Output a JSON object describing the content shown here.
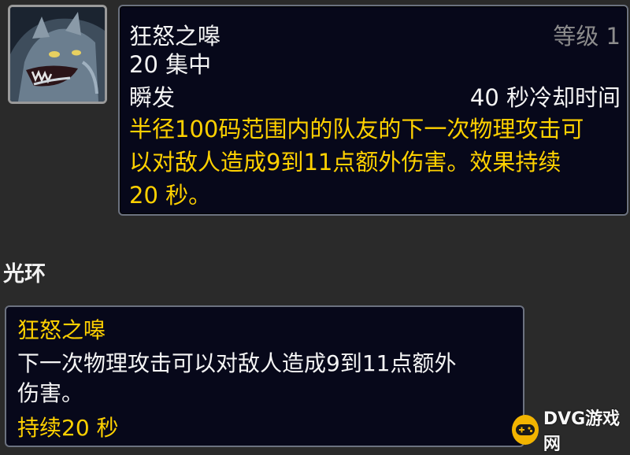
{
  "spell": {
    "name": "狂怒之嗥",
    "rank": "等级 1",
    "cost": "20 集中",
    "cast_time": "瞬发",
    "cooldown": "40 秒冷却时间",
    "description_lines": [
      "半径100码范围内的队友的下一次物理攻击可",
      "以对敌人造成9到11点额外伤害。效果持续",
      "20 秒。"
    ],
    "icon": "wolf-howl-icon"
  },
  "aura_section": {
    "heading": "光环",
    "name": "狂怒之嗥",
    "description_lines": [
      "下一次物理攻击可以对敌人造成9到11点额外",
      "伤害。"
    ],
    "duration": "持续20 秒"
  },
  "watermark": {
    "text": "DVG游戏网",
    "icon": "gamepad-icon"
  },
  "colors": {
    "gold": "#ffd100",
    "tooltip_bg": "#07081a",
    "page_bg": "#2a2a2a"
  }
}
